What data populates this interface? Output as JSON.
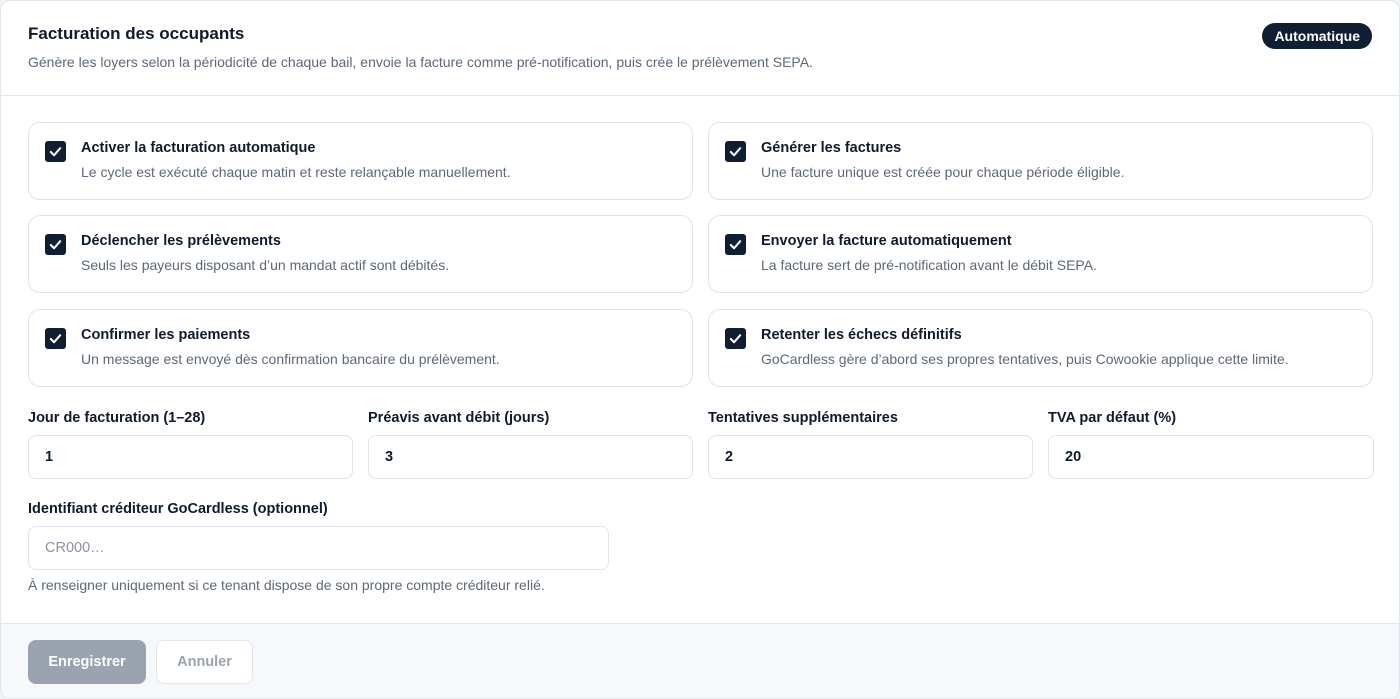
{
  "header": {
    "title": "Facturation des occupants",
    "subtitle": "Génère les loyers selon la périodicité de chaque bail, envoie la facture comme pré-notification, puis crée le prélèvement SEPA.",
    "badge": "Automatique"
  },
  "options": [
    {
      "label": "Activer la facturation automatique",
      "description": "Le cycle est exécuté chaque matin et reste relançable manuellement.",
      "checked": true
    },
    {
      "label": "Générer les factures",
      "description": "Une facture unique est créée pour chaque période éligible.",
      "checked": true
    },
    {
      "label": "Déclencher les prélèvements",
      "description": "Seuls les payeurs disposant d’un mandat actif sont débités.",
      "checked": true
    },
    {
      "label": "Envoyer la facture automatiquement",
      "description": "La facture sert de pré-notification avant le débit SEPA.",
      "checked": true
    },
    {
      "label": "Confirmer les paiements",
      "description": "Un message est envoyé dès confirmation bancaire du prélèvement.",
      "checked": true
    },
    {
      "label": "Retenter les échecs définitifs",
      "description": "GoCardless gère d’abord ses propres tentatives, puis Cowookie applique cette limite.",
      "checked": true
    }
  ],
  "fields": {
    "billing_day": {
      "label": "Jour de facturation (1–28)",
      "value": "1"
    },
    "notice_days": {
      "label": "Préavis avant débit (jours)",
      "value": "3"
    },
    "extra_attempts": {
      "label": "Tentatives supplémentaires",
      "value": "2"
    },
    "vat": {
      "label": "TVA par défaut (%)",
      "value": "20"
    },
    "creditor_id": {
      "label": "Identifiant créditeur GoCardless (optionnel)",
      "value": "",
      "placeholder": "CR000…",
      "hint": "À renseigner uniquement si ce tenant dispose de son propre compte créditeur relié."
    }
  },
  "footer": {
    "save_label": "Enregistrer",
    "cancel_label": "Annuler"
  }
}
